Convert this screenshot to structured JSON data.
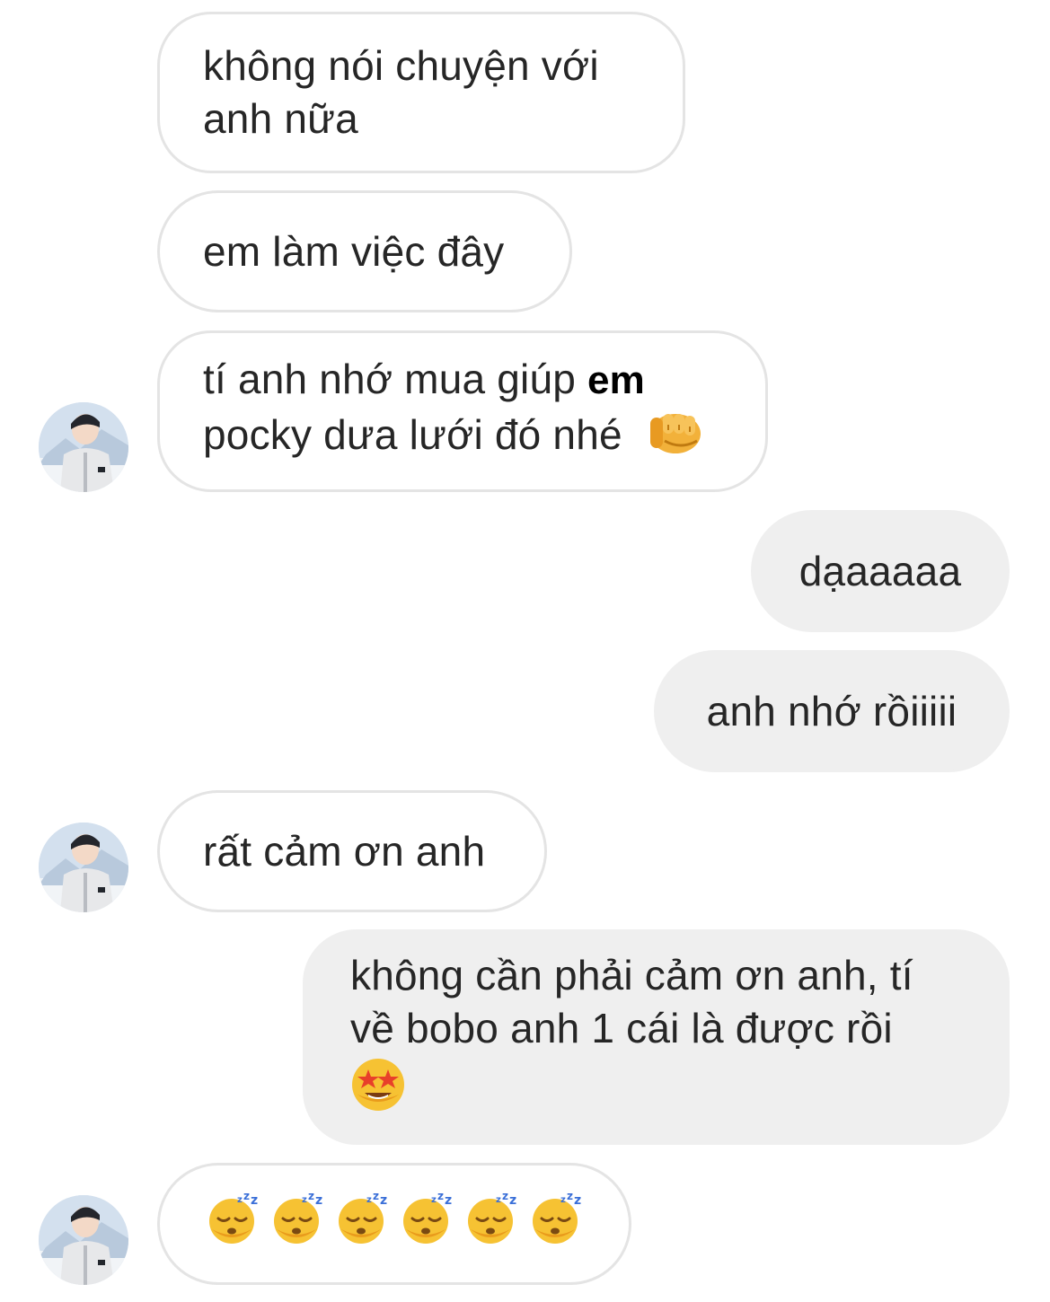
{
  "messages": [
    {
      "side": "in",
      "text": "không nói chuyện với\nanh nữa"
    },
    {
      "side": "in",
      "text": "em làm việc đây"
    },
    {
      "side": "in",
      "text_a": "tí anh nhớ mua giúp ",
      "text_bold": "em",
      "text_b": "pocky dưa lưới đó nhé",
      "emoji": "oncoming-fist-emoji"
    },
    {
      "side": "out",
      "text": "dạaaaaa"
    },
    {
      "side": "out",
      "text": "anh nhớ rồiiiii"
    },
    {
      "side": "in",
      "text": "rất cảm ơn anh"
    },
    {
      "side": "out",
      "text": "không cần phải cảm ơn anh, tí\nvề bobo anh 1 cái là được rồi",
      "emoji": "star-struck-emoji"
    },
    {
      "side": "in",
      "emoji": "sleeping-face-emoji",
      "emoji_count": 6
    }
  ],
  "avatar": {
    "icon": "user-avatar-photo"
  },
  "colors": {
    "incoming_bg": "#ffffff",
    "incoming_border": "#e4e4e4",
    "outgoing_bg": "#efefef",
    "text": "#262626"
  }
}
